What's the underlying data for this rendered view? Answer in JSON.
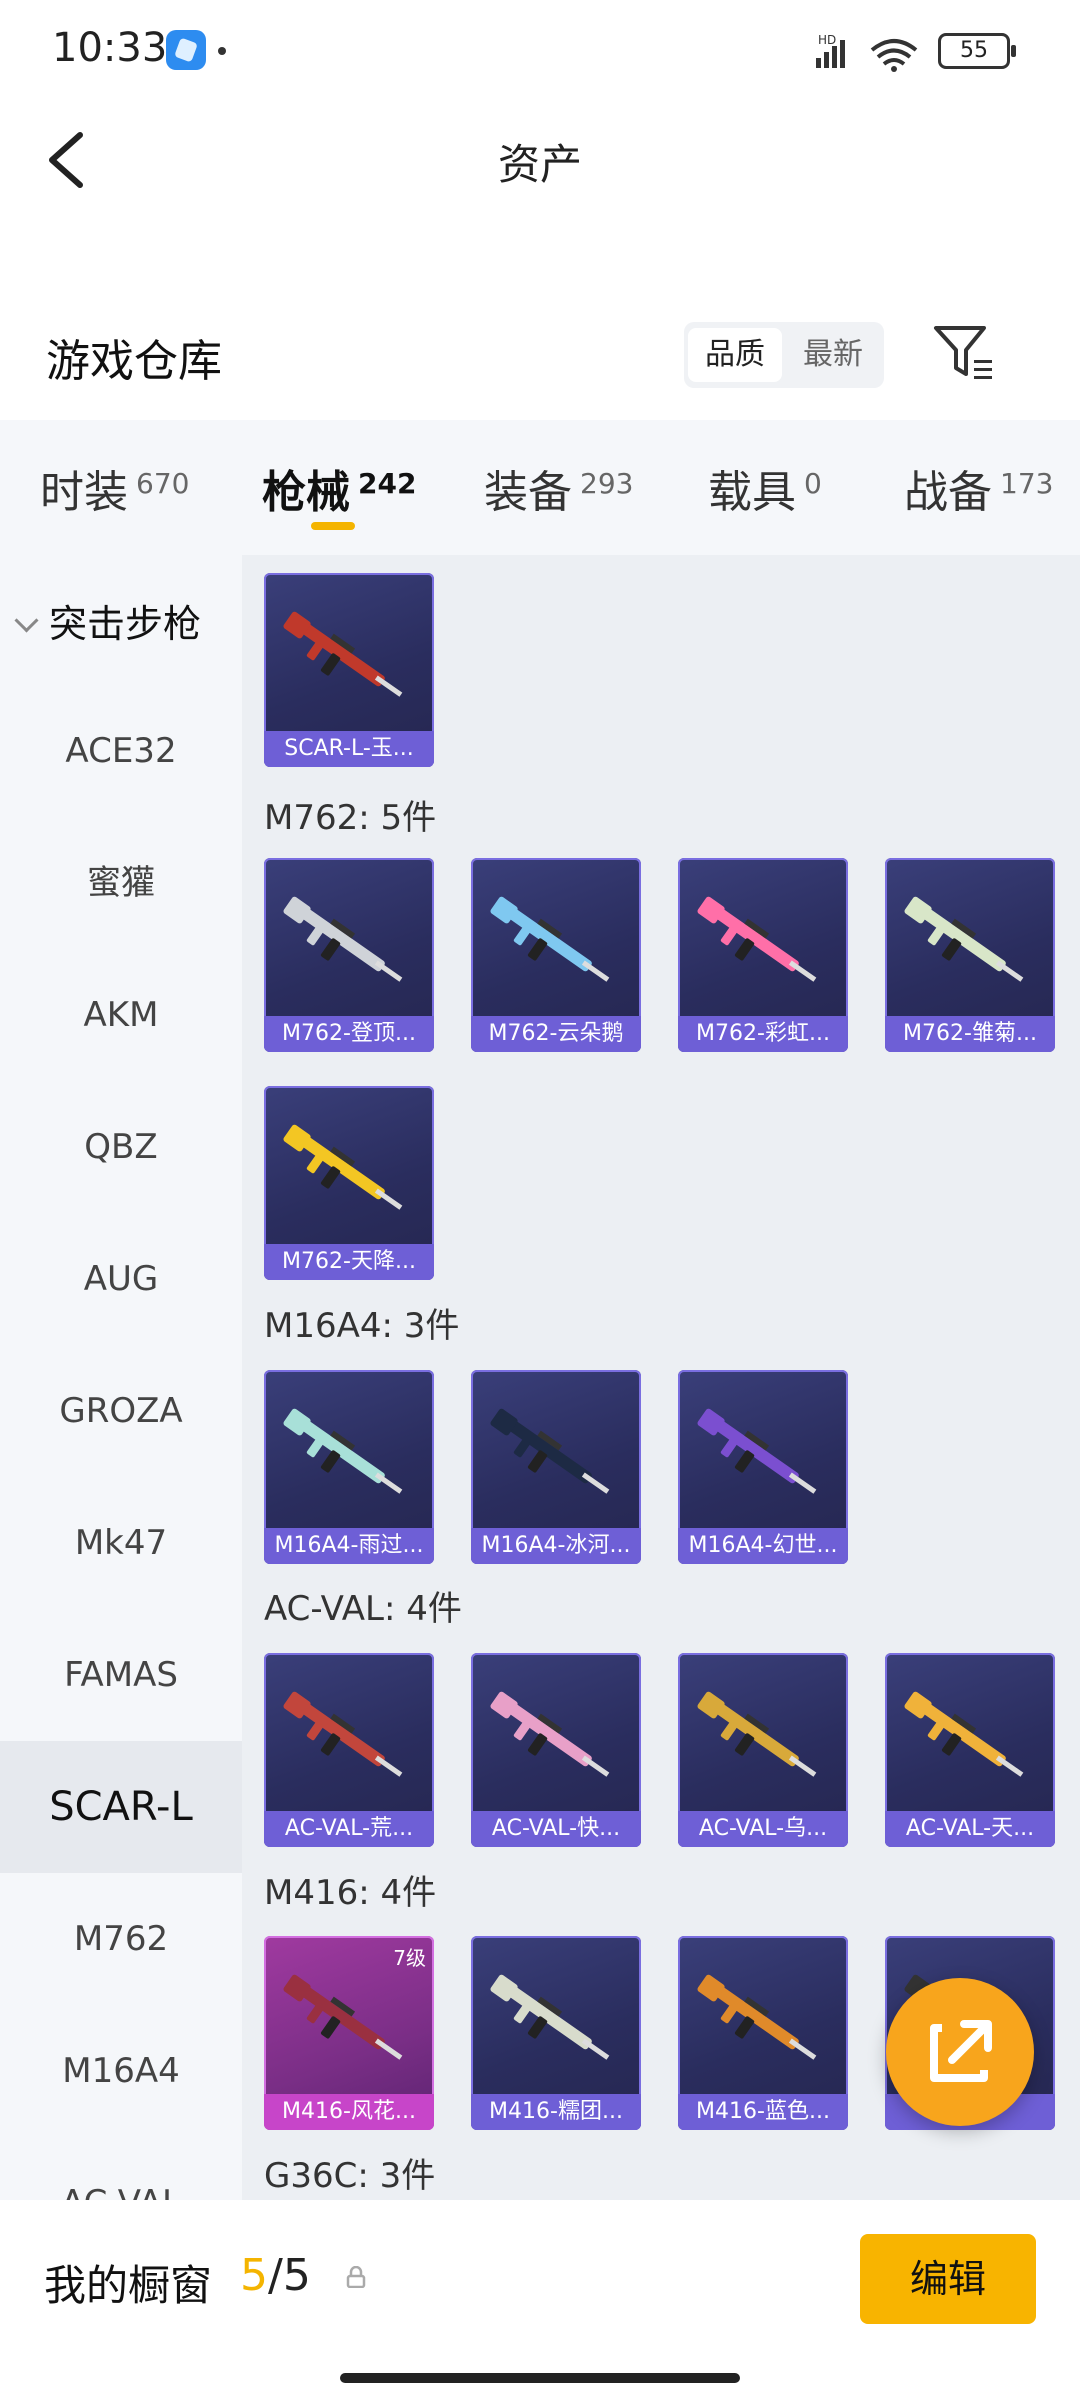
{
  "status": {
    "time": "10:33",
    "battery": "55"
  },
  "header": {
    "title": "资产"
  },
  "warehouse": {
    "title": "游戏仓库",
    "sort_quality": "品质",
    "sort_newest": "最新"
  },
  "tabs": [
    {
      "label": "时装",
      "count": "670"
    },
    {
      "label": "枪械",
      "count": "242"
    },
    {
      "label": "装备",
      "count": "293"
    },
    {
      "label": "载具",
      "count": "0"
    },
    {
      "label": "战备",
      "count": "173"
    }
  ],
  "sidebar": {
    "category": "突击步枪",
    "items": [
      "ACE32",
      "蜜獾",
      "AKM",
      "QBZ",
      "AUG",
      "GROZA",
      "Mk47",
      "FAMAS",
      "SCAR-L",
      "M762",
      "M16A4",
      "AC-VAL"
    ],
    "selected": "SCAR-L"
  },
  "groups": [
    {
      "label": "",
      "items": [
        {
          "name": "SCAR-L-玉..."
        }
      ]
    },
    {
      "label": "M762: 5件",
      "items": [
        {
          "name": "M762-登顶..."
        },
        {
          "name": "M762-云朵鹅"
        },
        {
          "name": "M762-彩虹..."
        },
        {
          "name": "M762-雏菊..."
        },
        {
          "name": "M762-天降..."
        }
      ]
    },
    {
      "label": "M16A4: 3件",
      "items": [
        {
          "name": "M16A4-雨过..."
        },
        {
          "name": "M16A4-冰河..."
        },
        {
          "name": "M16A4-幻世..."
        }
      ]
    },
    {
      "label": "AC-VAL: 4件",
      "items": [
        {
          "name": "AC-VAL-荒..."
        },
        {
          "name": "AC-VAL-快..."
        },
        {
          "name": "AC-VAL-乌..."
        },
        {
          "name": "AC-VAL-天..."
        }
      ]
    },
    {
      "label": "M416: 4件",
      "items": [
        {
          "name": "M416-风花...",
          "level": "7级"
        },
        {
          "name": "M416-糯团..."
        },
        {
          "name": "M416-蓝色..."
        },
        {
          "name": ""
        }
      ]
    },
    {
      "label": "G36C: 3件",
      "items": []
    }
  ],
  "gun_colors": [
    "#c0392b",
    "#cfd3d8",
    "#7fc8f0",
    "#ff6fa8",
    "#d8e6c8",
    "#f3c623",
    "#a8e0d8",
    "#1d2a44",
    "#7b4fd0",
    "#c2463c",
    "#e8a0c8",
    "#d8a93a",
    "#f0b23a",
    "#9a3040",
    "#d8dccc",
    "#e08a2a",
    "#333333"
  ],
  "showcase": {
    "label": "我的橱窗",
    "current": "5",
    "total": "/5",
    "edit": "编辑"
  }
}
